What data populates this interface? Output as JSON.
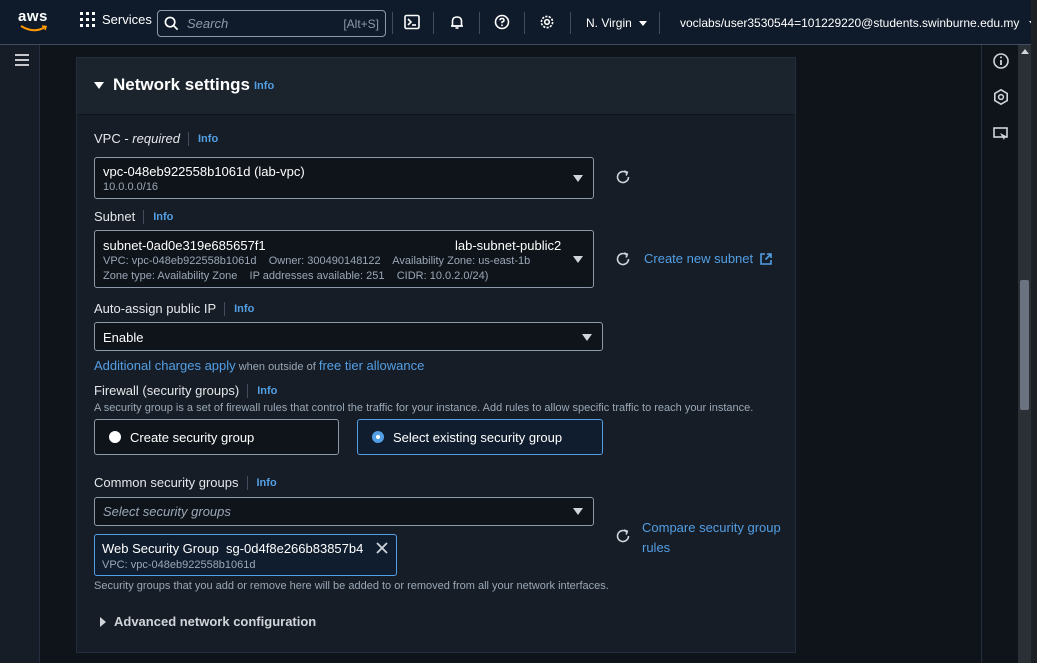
{
  "topnav": {
    "logo_text": "aws",
    "services_label": "Services",
    "search_placeholder": "Search",
    "search_shortcut": "[Alt+S]",
    "region": "N. Virgin",
    "account": "voclabs/user3530544=101229220@students.swinburne.edu.my"
  },
  "network": {
    "title": "Network settings",
    "info": "Info",
    "vpc": {
      "label_prefix": "VPC - ",
      "label_required": "required",
      "info": "Info",
      "value": "vpc-048eb922558b1061d (lab-vpc)",
      "cidr": "10.0.0.0/16"
    },
    "subnet": {
      "label": "Subnet",
      "info": "Info",
      "id": "subnet-0ad0e319e685657f1",
      "name": "lab-subnet-public2",
      "line2": "VPC: vpc-048eb922558b1061d    Owner: 300490148122    Availability Zone: us-east-1b",
      "line3": "Zone type: Availability Zone    IP addresses available: 251    CIDR: 10.0.2.0/24)",
      "create_link": "Create new subnet"
    },
    "public_ip": {
      "label": "Auto-assign public IP",
      "info": "Info",
      "value": "Enable",
      "charges_link": "Additional charges apply",
      "charges_text": " when outside of ",
      "tier_link": "free tier allowance"
    },
    "firewall": {
      "label": "Firewall (security groups)",
      "info": "Info",
      "description": "A security group is a set of firewall rules that control the traffic for your instance. Add rules to allow specific traffic to reach your instance.",
      "option_create": "Create security group",
      "option_existing": "Select existing security group",
      "selected": "existing"
    },
    "common_sg": {
      "label": "Common security groups",
      "info": "Info",
      "placeholder": "Select security groups",
      "compare_link_line1": "Compare security group",
      "compare_link_line2": "rules",
      "token_name": "Web Security Group",
      "token_id": "sg-0d4f8e266b83857b4",
      "token_vpc": "VPC: vpc-048eb922558b1061d",
      "note": "Security groups that you add or remove here will be added to or removed from all your network interfaces."
    },
    "advanced": "Advanced network configuration"
  },
  "colors": {
    "accent": "#539fe5",
    "panel_bg": "#161d26",
    "page_bg": "#0f141a"
  }
}
